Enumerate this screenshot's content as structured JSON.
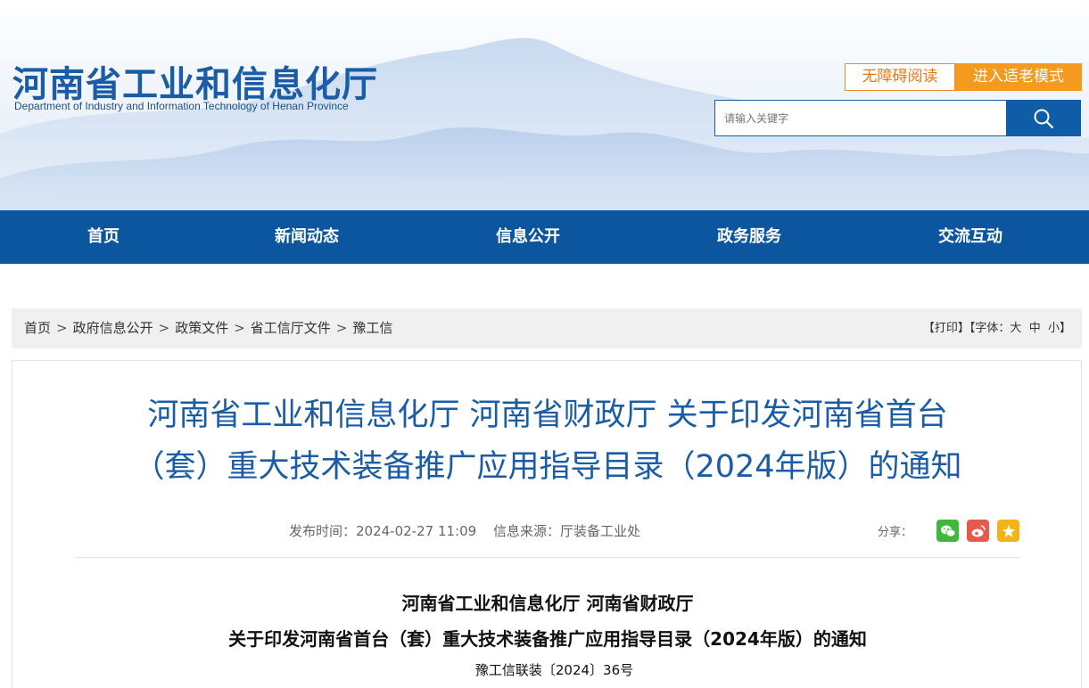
{
  "header": {
    "logo_cn": "河南省工业和信息化厅",
    "logo_en": "Department of Industry and Information Technology of Henan Province",
    "accessibility_label": "无障碍阅读",
    "elder_mode_label": "进入适老模式",
    "search_placeholder": "请输入关键字",
    "search_icon": "search-icon"
  },
  "nav": {
    "items": [
      {
        "label": "首页"
      },
      {
        "label": "新闻动态"
      },
      {
        "label": "信息公开"
      },
      {
        "label": "政务服务"
      },
      {
        "label": "交流互动"
      }
    ]
  },
  "breadcrumb": {
    "items": [
      "首页",
      "政府信息公开",
      "政策文件",
      "省工信厅文件",
      "豫工信"
    ],
    "separator": ">",
    "print_label": "【打印】",
    "font_label": "【字体：",
    "font_large": "大",
    "font_medium": "中",
    "font_small": "小",
    "font_close": "】"
  },
  "article": {
    "title_line1": "河南省工业和信息化厅 河南省财政厅 关于印发河南省首台",
    "title_line2": "（套）重大技术装备推广应用指导目录（2024年版）的通知",
    "publish_time": "发布时间：2024-02-27 11:09",
    "source": "信息来源：厅装备工业处",
    "share_label": "分享：",
    "share_icons": [
      "wechat-icon",
      "weibo-icon",
      "favorite-icon"
    ],
    "doc_title_line1": "河南省工业和信息化厅 河南省财政厅",
    "doc_title_line2": "关于印发河南省首台（套）重大技术装备推广应用指导目录（2024年版）的通知",
    "doc_number": "豫工信联装〔2024〕36号"
  },
  "colors": {
    "brand_blue": "#1a5ca5",
    "nav_blue": "#0c559f",
    "orange": "#f39a1f"
  }
}
